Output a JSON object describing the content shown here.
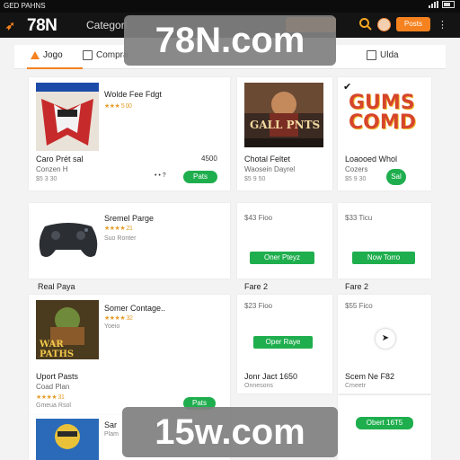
{
  "status_bar": {
    "left_text": "GED PAHNS"
  },
  "header": {
    "logo": "78N",
    "nav_label": "Categori",
    "cta_label": "Posts",
    "menu_glyph": "⋮"
  },
  "watermarks": {
    "top": "78N.com",
    "bottom": "15w.com"
  },
  "tabs": [
    {
      "label": "Jogo"
    },
    {
      "label": "Compra"
    },
    {
      "label": "Ulda"
    }
  ],
  "cards": {
    "r1c1": {
      "title": "Wolde Fee Fdgt",
      "stars": "★★★ 5 00",
      "name": "Caro Prét sal",
      "sub": "Conzen H",
      "price": "$5 3 30",
      "tag": "4500",
      "meta": "• •  ? ",
      "button": "Pats"
    },
    "r1c2": {
      "art_title": "GALL PNTS",
      "name": "Chotal Feltet",
      "sub": "Waosein Dayrel",
      "price": "$5 9 50"
    },
    "r1c3": {
      "art_title": "GUMS COMD",
      "name": "Loaooed Whol",
      "sub": "Cozers",
      "price": "$5 9 30",
      "button": "Sal"
    },
    "r2c1": {
      "title": "Sremel Parge",
      "stars": "★★★★ 21",
      "sub": "Suo Ronter"
    },
    "r2c2": {
      "price": "$43 Fioo",
      "button": "Oner Pteyz"
    },
    "r2c3": {
      "price": "$33 Ticu",
      "button": "Now Torro"
    }
  },
  "sections": {
    "s1": "Real Paya",
    "s2": "Fare 2",
    "s3": "Fare 2"
  },
  "row3": {
    "c1": {
      "title": "Somer Contage..",
      "stars": "★★★★ 32",
      "sub": "Yoeio",
      "art_title": "WAR PATHS",
      "name": "Uport Pasts",
      "sub2": "Coad Plan",
      "stars2": "★★★★ 31",
      "meta": "Gmeua Rsol",
      "button": "Pats"
    },
    "c2": {
      "price": "$23 Fioo",
      "button": "Oper Raye",
      "name": "Jonr Jact 1650",
      "sub": "Onnesons"
    },
    "c3": {
      "price": "$55 Fico",
      "name": "Scem Ne F82",
      "sub": "Cmeetr"
    }
  },
  "row4": {
    "c1": {
      "title": "Sar",
      "sub": "Plam"
    },
    "c3": {
      "button": "Obert 16T5"
    }
  }
}
